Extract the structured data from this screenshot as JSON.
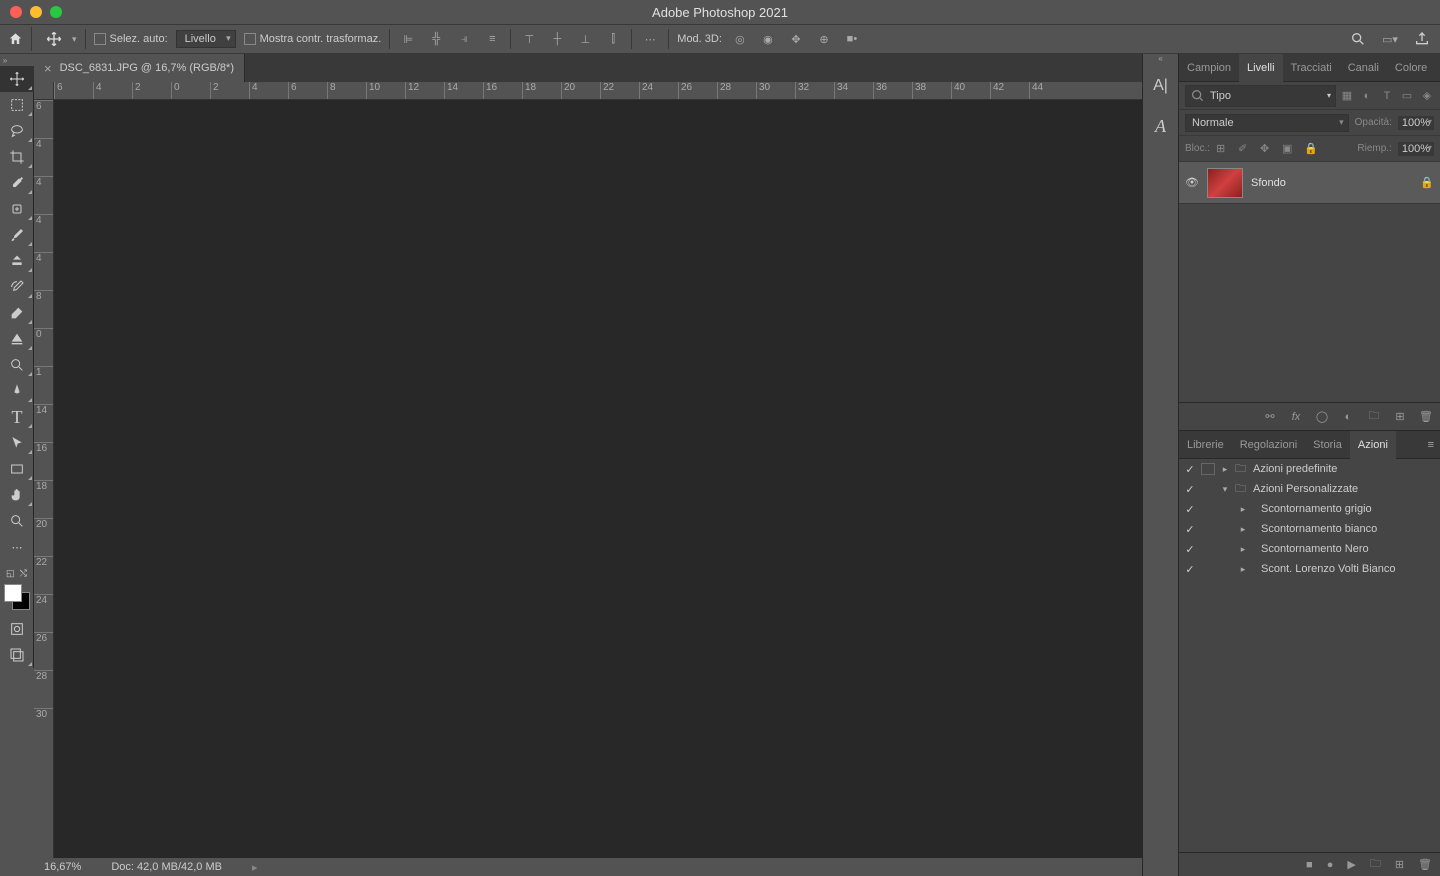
{
  "app_title": "Adobe Photoshop 2021",
  "options_bar": {
    "auto_select_label": "Selez. auto:",
    "auto_select_target": "Livello",
    "show_transform_label": "Mostra contr. trasformaz.",
    "mode_3d_label": "Mod. 3D:"
  },
  "document": {
    "tab_title": "DSC_6831.JPG @ 16,7% (RGB/8*)"
  },
  "ruler_h": [
    "6",
    "4",
    "2",
    "0",
    "2",
    "4",
    "6",
    "8",
    "10",
    "12",
    "14",
    "16",
    "18",
    "20",
    "22",
    "24",
    "26",
    "28",
    "30",
    "32",
    "34",
    "36",
    "38",
    "40",
    "42",
    "44"
  ],
  "ruler_v": [
    "6",
    "4",
    "4",
    "4",
    "4",
    "8",
    "0",
    "1",
    "14",
    "16",
    "18",
    "20",
    "22",
    "24",
    "26",
    "28",
    "30"
  ],
  "status_bar": {
    "zoom": "16,67%",
    "doc_info": "Doc: 42,0 MB/42,0 MB"
  },
  "panels": {
    "top_tabs": [
      "Campion",
      "Livelli",
      "Tracciati",
      "Canali",
      "Colore"
    ],
    "top_active": "Livelli",
    "layer_filter_placeholder": "Tipo",
    "blend_mode": "Normale",
    "opacity_label": "Opacità:",
    "opacity_value": "100%",
    "lock_label": "Bloc.:",
    "fill_label": "Riemp.:",
    "fill_value": "100%",
    "layers": [
      {
        "name": "Sfondo",
        "locked": true
      }
    ],
    "bottom_tabs": [
      "Librerie",
      "Regolazioni",
      "Storia",
      "Azioni"
    ],
    "bottom_active": "Azioni",
    "actions": [
      {
        "indent": 0,
        "expand": "▸",
        "folder": true,
        "box": true,
        "name": "Azioni predefinite"
      },
      {
        "indent": 0,
        "expand": "▾",
        "folder": true,
        "box": false,
        "name": "Azioni Personalizzate"
      },
      {
        "indent": 1,
        "expand": "▸",
        "folder": false,
        "box": false,
        "name": "Scontornamento grigio"
      },
      {
        "indent": 1,
        "expand": "▸",
        "folder": false,
        "box": false,
        "name": "Scontornamento bianco"
      },
      {
        "indent": 1,
        "expand": "▸",
        "folder": false,
        "box": false,
        "name": "Scontornamento Nero"
      },
      {
        "indent": 1,
        "expand": "▸",
        "folder": false,
        "box": false,
        "name": "Scont. Lorenzo Volti Bianco"
      }
    ]
  }
}
